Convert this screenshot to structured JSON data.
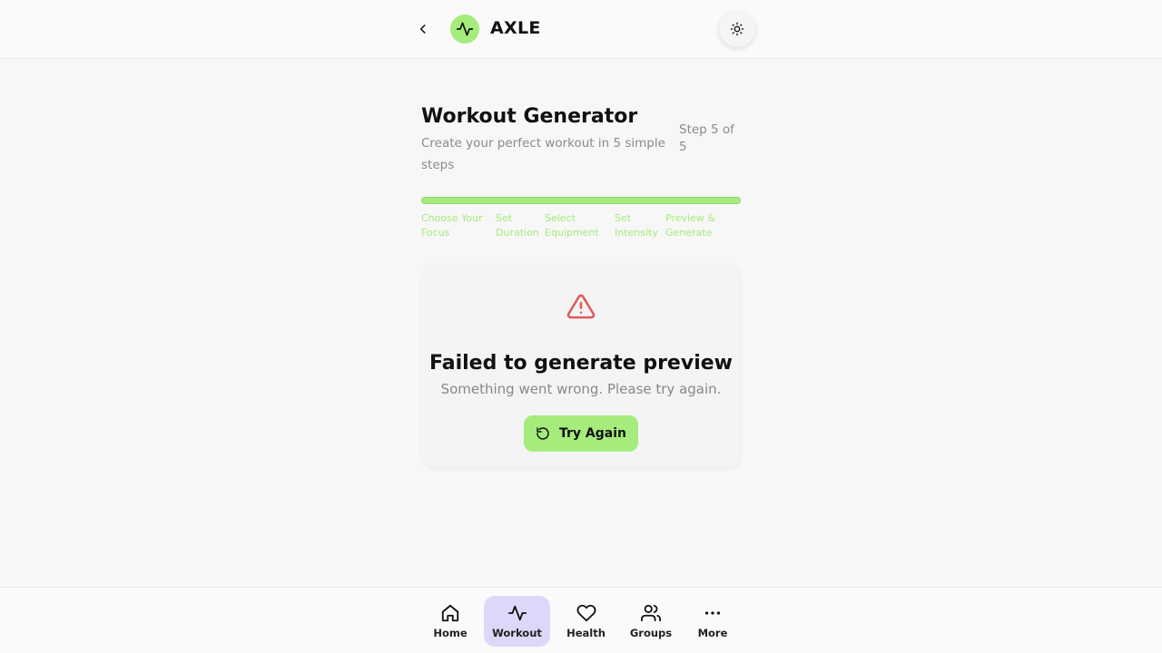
{
  "header": {
    "brand": "AXLE",
    "icons": {
      "back": "chevron-left-icon",
      "logo": "activity-icon",
      "theme": "sun-icon"
    }
  },
  "page": {
    "title": "Workout Generator",
    "subtitle": "Create your perfect workout in 5 simple steps",
    "step_indicator": "Step 5 of 5",
    "progress_fraction": 1.0
  },
  "steps": [
    {
      "label": "Choose Your Focus"
    },
    {
      "label": "Set Duration"
    },
    {
      "label": "Select Equipment"
    },
    {
      "label": "Set Intensity"
    },
    {
      "label": "Preview & Generate"
    }
  ],
  "error": {
    "icon": "warning-triangle-icon",
    "title": "Failed to generate preview",
    "message": "Something went wrong. Please try again.",
    "retry_label": "Try Again"
  },
  "nav": {
    "items": [
      {
        "label": "Home",
        "icon": "home-icon",
        "active": false
      },
      {
        "label": "Workout",
        "icon": "activity-icon",
        "active": true
      },
      {
        "label": "Health",
        "icon": "heart-icon",
        "active": false
      },
      {
        "label": "Groups",
        "icon": "users-icon",
        "active": false
      },
      {
        "label": "More",
        "icon": "more-horizontal-icon",
        "active": false
      }
    ]
  },
  "colors": {
    "accent": "#a6ec7c",
    "active_nav_bg": "#ddd7f9",
    "error_red": "#e05a5a"
  }
}
